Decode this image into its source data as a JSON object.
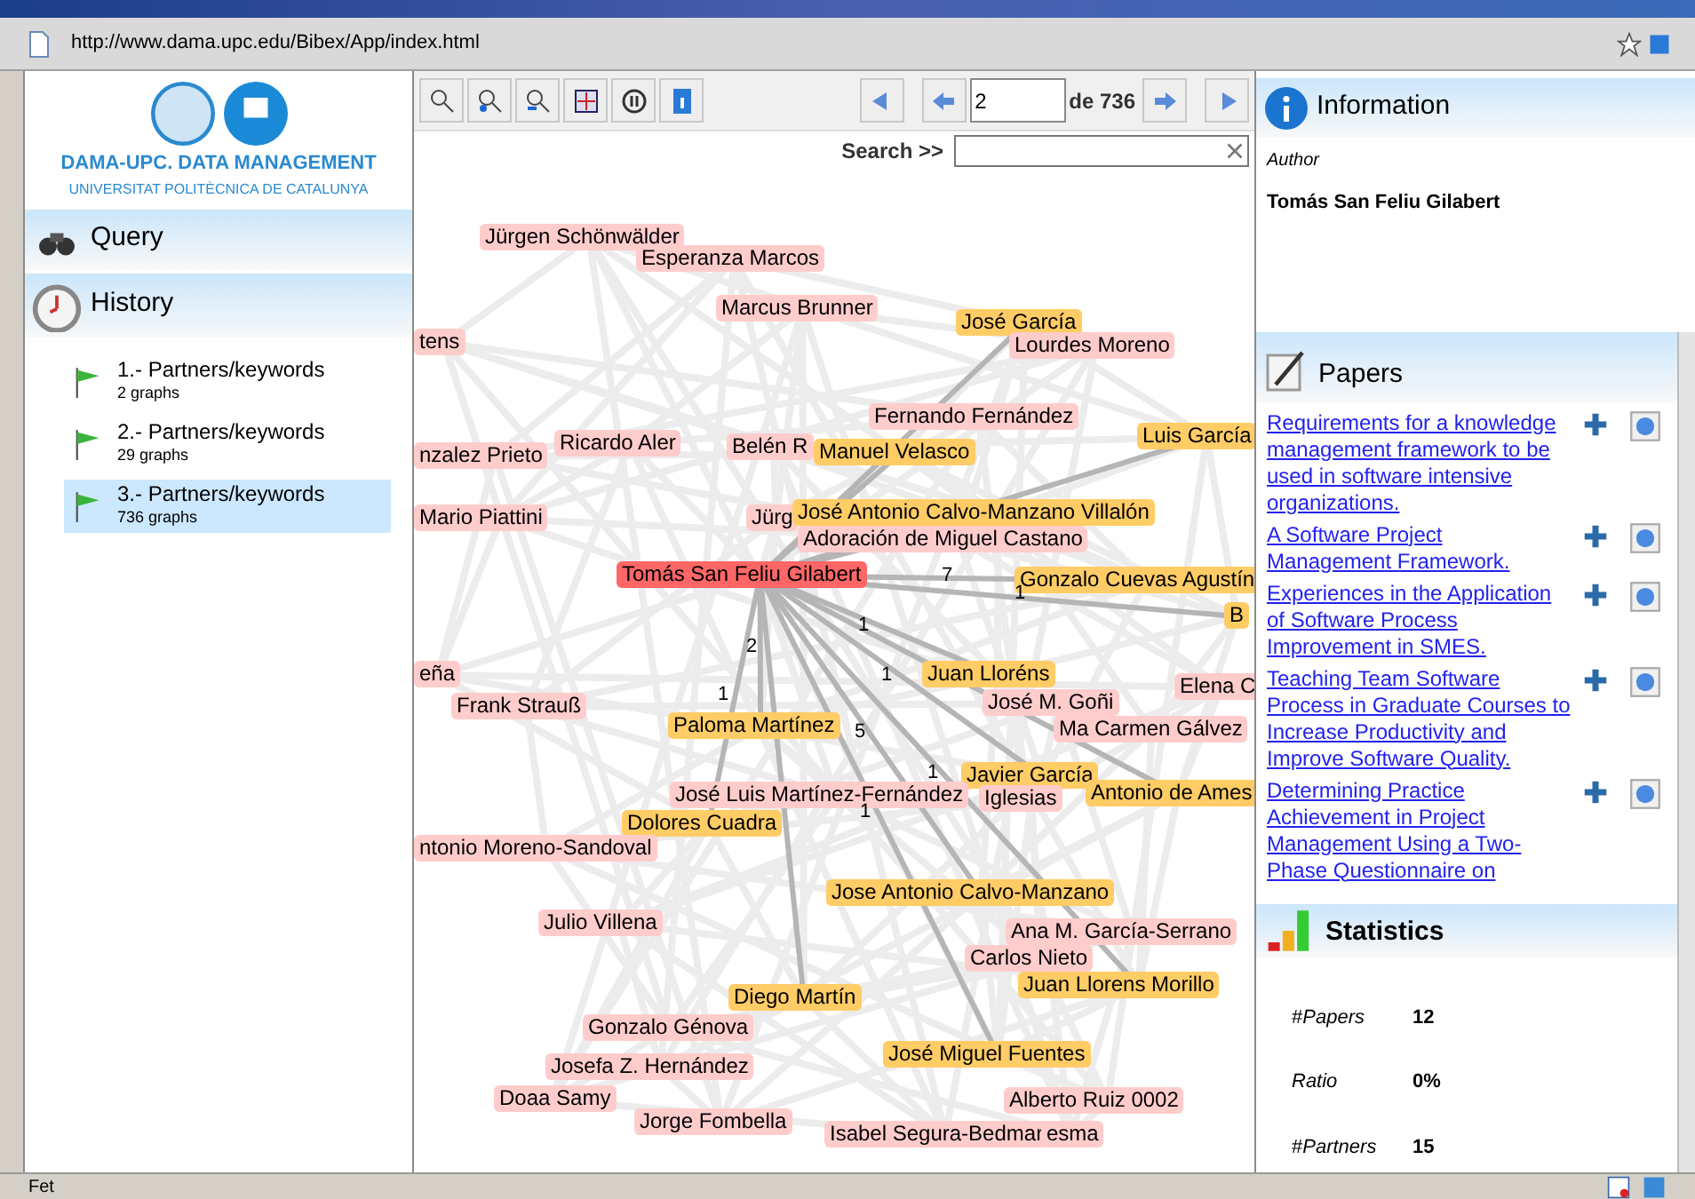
{
  "address_bar": {
    "url": "http://www.dama.upc.edu/Bibex/App/index.html"
  },
  "sidebar": {
    "logo_title": "DAMA-UPC. DATA MANAGEMENT",
    "logo_subtitle": "UNIVERSITAT POLITÈCNICA DE CATALUNYA",
    "query_label": "Query",
    "history_label": "History",
    "history": [
      {
        "title": "1.- Partners/keywords",
        "count": "2 graphs",
        "selected": false
      },
      {
        "title": "2.- Partners/keywords",
        "count": "29 graphs",
        "selected": false
      },
      {
        "title": "3.- Partners/keywords",
        "count": "736 graphs",
        "selected": true
      }
    ]
  },
  "toolbar": {
    "page": "2",
    "page_total": "de 736",
    "search_label": "Search >>"
  },
  "graph": {
    "nodes": [
      {
        "label": "Jürgen Schönwälder",
        "kind": "author"
      },
      {
        "label": "Esperanza Marcos",
        "kind": "author"
      },
      {
        "label": "Marcus Brunner",
        "kind": "author"
      },
      {
        "label": "tens",
        "kind": "author"
      },
      {
        "label": "José García",
        "kind": "partner"
      },
      {
        "label": "Lourdes Moreno",
        "kind": "author"
      },
      {
        "label": "Fernando Fernández",
        "kind": "author"
      },
      {
        "label": "Luis García",
        "kind": "partner"
      },
      {
        "label": "nzalez Prieto",
        "kind": "author"
      },
      {
        "label": "Ricardo Aler",
        "kind": "author"
      },
      {
        "label": "Belén R",
        "kind": "author"
      },
      {
        "label": "Manuel Velasco",
        "kind": "partner"
      },
      {
        "label": "Mario Piattini",
        "kind": "author"
      },
      {
        "label": "Jürg",
        "kind": "author"
      },
      {
        "label": "José Antonio Calvo-Manzano Villalón",
        "kind": "partner"
      },
      {
        "label": "Adoración de Miguel Castano",
        "kind": "author"
      },
      {
        "label": "Tomás San Feliu Gilabert",
        "kind": "focus"
      },
      {
        "label": "Gonzalo Cuevas Agustín",
        "kind": "partner"
      },
      {
        "label": "B",
        "kind": "partner"
      },
      {
        "label": "eña",
        "kind": "author"
      },
      {
        "label": "Frank Strauß",
        "kind": "author"
      },
      {
        "label": "Juan Lloréns",
        "kind": "partner"
      },
      {
        "label": "Elena C",
        "kind": "author"
      },
      {
        "label": "José M. Goñi",
        "kind": "author"
      },
      {
        "label": "Paloma Martínez",
        "kind": "partner"
      },
      {
        "label": "Ma Carmen Gálvez",
        "kind": "author"
      },
      {
        "label": "Javier García",
        "kind": "partner"
      },
      {
        "label": "José Luis Martínez-Fernández",
        "kind": "author"
      },
      {
        "label": "Iglesias",
        "kind": "author"
      },
      {
        "label": "Antonio de Ames",
        "kind": "partner"
      },
      {
        "label": "Dolores Cuadra",
        "kind": "partner"
      },
      {
        "label": "ntonio Moreno-Sandoval",
        "kind": "author"
      },
      {
        "label": "Jose Antonio Calvo-Manzano",
        "kind": "partner"
      },
      {
        "label": "Julio Villena",
        "kind": "author"
      },
      {
        "label": "Ana M. García-Serrano",
        "kind": "author"
      },
      {
        "label": "Carlos Nieto",
        "kind": "author"
      },
      {
        "label": "Juan Llorens Morillo",
        "kind": "partner"
      },
      {
        "label": "Diego Martín",
        "kind": "partner"
      },
      {
        "label": "Gonzalo Génova",
        "kind": "author"
      },
      {
        "label": "José Miguel Fuentes",
        "kind": "partner"
      },
      {
        "label": "Josefa Z. Hernández",
        "kind": "author"
      },
      {
        "label": "Doaa Samy",
        "kind": "author"
      },
      {
        "label": "Alberto Ruiz 0002",
        "kind": "author"
      },
      {
        "label": "Jorge Fombella",
        "kind": "author"
      },
      {
        "label": "Isabel Segura-Bedmar",
        "kind": "author"
      },
      {
        "label": "esma",
        "kind": "author"
      }
    ],
    "edge_labels": [
      "7",
      "1",
      "2",
      "1",
      "1",
      "1",
      "5",
      "1",
      "1"
    ]
  },
  "information": {
    "title": "Information",
    "field_label": "Author",
    "author": "Tomás San Feliu Gilabert"
  },
  "papers": {
    "title": "Papers",
    "items": [
      "Requirements for a knowledge management framework to be used in software intensive organizations.",
      "A Software Project Management Framework.",
      "Experiences in the Application of Software Process Improvement in SMES.",
      "Teaching Team Software Process in Graduate Courses to Increase Productivity and Improve Software Quality.",
      "Determining Practice Achievement in Project Management Using a Two-Phase Questionnaire on"
    ]
  },
  "statistics": {
    "title": "Statistics",
    "rows": [
      {
        "label": "#*Papers*",
        "value": "12"
      },
      {
        "label": "*Ratio*",
        "value": "0%"
      },
      {
        "label": "#*Partners*",
        "value": "15"
      }
    ]
  },
  "status_bar": {
    "text": "Fet"
  }
}
